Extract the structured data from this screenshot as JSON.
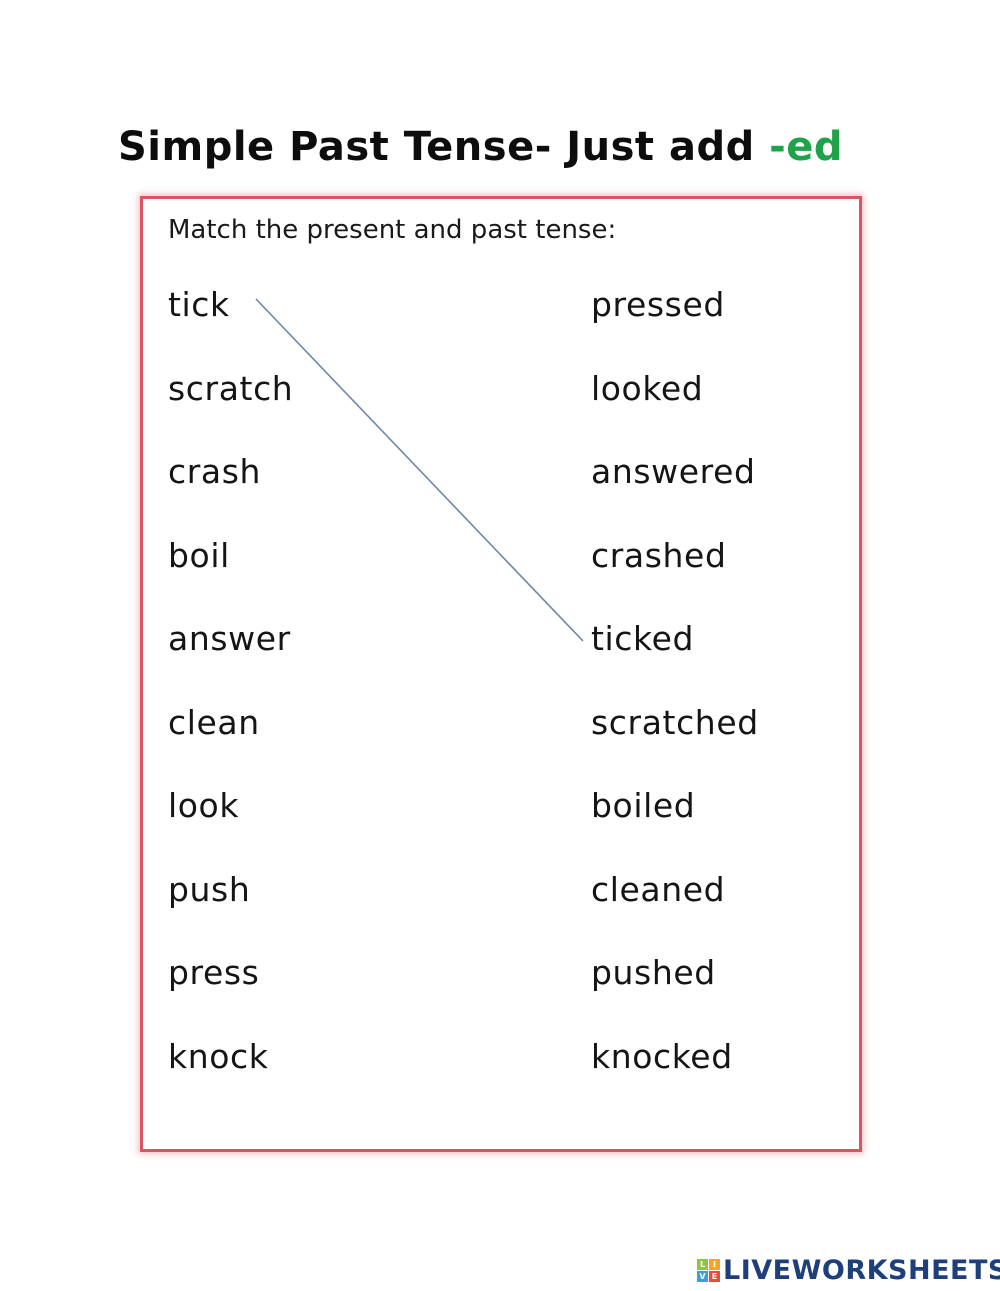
{
  "title": {
    "main": "Simple Past Tense- Just add ",
    "accent": "-ed"
  },
  "colors": {
    "accent": "#1fa24a",
    "border": "#d9555f",
    "connector": "#6f86a8",
    "logo": "#1e3f7a"
  },
  "instruction": "Match the present and past tense:",
  "present": [
    "tick",
    "scratch",
    "crash",
    "boil",
    "answer",
    "clean",
    "look",
    "push",
    "press",
    "knock"
  ],
  "past": [
    "pressed",
    "looked",
    "answered",
    "crashed",
    "ticked",
    "scratched",
    "boiled",
    "cleaned",
    "pushed",
    "knocked"
  ],
  "matches": [
    {
      "from": "tick",
      "to": "ticked"
    }
  ],
  "logo": {
    "tiles": [
      {
        "letter": "L",
        "color": "#8cc63f"
      },
      {
        "letter": "I",
        "color": "#f5a623"
      },
      {
        "letter": "V",
        "color": "#3aa0dc"
      },
      {
        "letter": "E",
        "color": "#e94e3c"
      }
    ],
    "text": "LIVEWORKSHEETS"
  }
}
